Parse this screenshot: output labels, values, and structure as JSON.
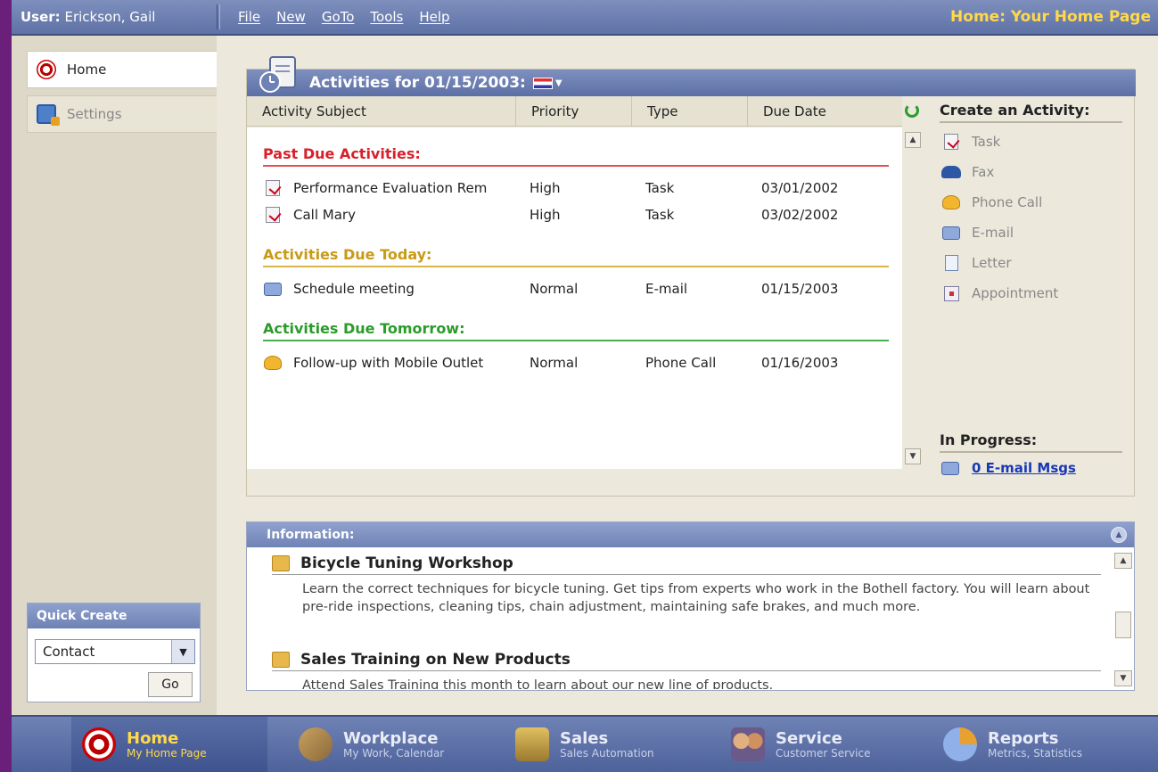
{
  "header": {
    "user_label": "User:",
    "user_name": "Erickson, Gail",
    "menu": [
      "File",
      "New",
      "GoTo",
      "Tools",
      "Help"
    ],
    "page_title": "Home: Your Home Page"
  },
  "sidebar": {
    "items": [
      {
        "label": "Home",
        "icon": "target-icon"
      },
      {
        "label": "Settings",
        "icon": "settings-icon"
      }
    ]
  },
  "quick_create": {
    "title": "Quick Create",
    "selected": "Contact",
    "go_label": "Go"
  },
  "activities": {
    "title": "Activities for 01/15/2003:",
    "columns": [
      "Activity Subject",
      "Priority",
      "Type",
      "Due Date"
    ],
    "sections": {
      "past_due": "Past Due Activities:",
      "today": "Activities Due Today:",
      "tomorrow": "Activities Due Tomorrow:"
    },
    "rows": [
      {
        "subject": "Performance Evaluation Rem",
        "priority": "High",
        "type": "Task",
        "due": "03/01/2002",
        "icon": "task-icon"
      },
      {
        "subject": "Call Mary",
        "priority": "High",
        "type": "Task",
        "due": "03/02/2002",
        "icon": "task-icon"
      },
      {
        "subject": "Schedule meeting",
        "priority": "Normal",
        "type": "E-mail",
        "due": "01/15/2003",
        "icon": "email-icon"
      },
      {
        "subject": "Follow-up with Mobile Outlet",
        "priority": "Normal",
        "type": "Phone Call",
        "due": "01/16/2003",
        "icon": "phone-icon"
      }
    ]
  },
  "create_activity": {
    "title": "Create an Activity:",
    "items": [
      "Task",
      "Fax",
      "Phone Call",
      "E-mail",
      "Letter",
      "Appointment"
    ]
  },
  "in_progress": {
    "title": "In Progress:",
    "link": "0 E-mail Msgs"
  },
  "information": {
    "title": "Information:",
    "items": [
      {
        "title": "Bicycle Tuning Workshop",
        "desc": "Learn the correct techniques for bicycle tuning. Get tips from experts who work in the Bothell factory. You will learn about pre-ride inspections, cleaning tips, chain adjustment, maintaining safe brakes, and much more."
      },
      {
        "title": "Sales Training on New Products",
        "desc": "Attend Sales Training this month to learn about our new line of products."
      }
    ]
  },
  "bottom_nav": [
    {
      "title": "Home",
      "subtitle": "My Home Page"
    },
    {
      "title": "Workplace",
      "subtitle": "My Work, Calendar"
    },
    {
      "title": "Sales",
      "subtitle": "Sales Automation"
    },
    {
      "title": "Service",
      "subtitle": "Customer Service"
    },
    {
      "title": "Reports",
      "subtitle": "Metrics, Statistics"
    }
  ],
  "colors": {
    "header_blue": "#5f72a6",
    "title_yellow": "#ffd94a",
    "past_due_red": "#d8202a",
    "today_gold": "#c99a14",
    "tomorrow_green": "#2a9c2a",
    "link_blue": "#1838b8"
  }
}
